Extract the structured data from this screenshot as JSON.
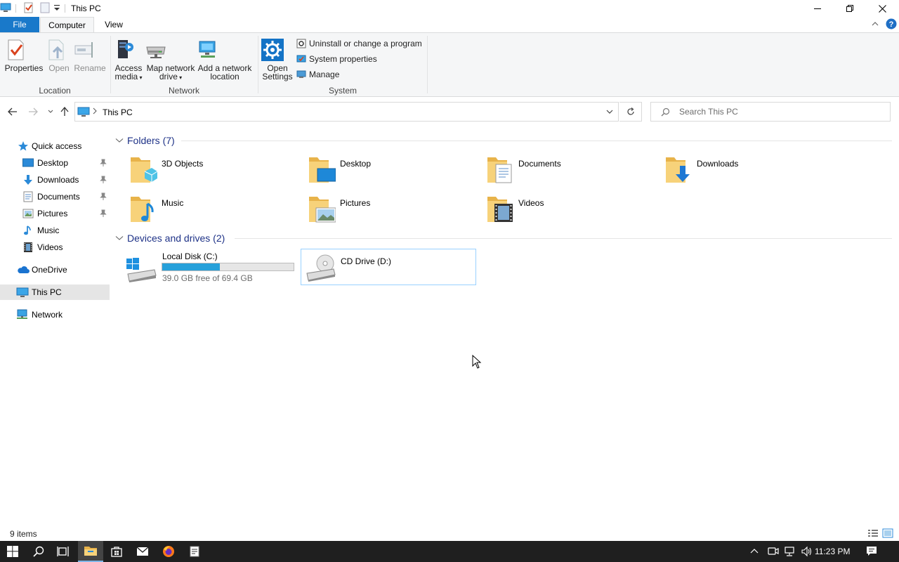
{
  "window": {
    "title": "This PC"
  },
  "ribbon_tabs": {
    "file": "File",
    "computer": "Computer",
    "view": "View"
  },
  "ribbon": {
    "location": {
      "label": "Location",
      "properties": "Properties",
      "open": "Open",
      "rename": "Rename"
    },
    "network": {
      "label": "Network",
      "access_media_1": "Access",
      "access_media_2": "media",
      "map_drive_1": "Map network",
      "map_drive_2": "drive",
      "add_location_1": "Add a network",
      "add_location_2": "location"
    },
    "system": {
      "label": "System",
      "open_settings_1": "Open",
      "open_settings_2": "Settings",
      "uninstall": "Uninstall or change a program",
      "system_properties": "System properties",
      "manage": "Manage"
    }
  },
  "address": {
    "path": "This PC",
    "search_placeholder": "Search This PC"
  },
  "nav_pane": {
    "quick_access": "Quick access",
    "items": [
      {
        "label": "Desktop",
        "pinned": true
      },
      {
        "label": "Downloads",
        "pinned": true
      },
      {
        "label": "Documents",
        "pinned": true
      },
      {
        "label": "Pictures",
        "pinned": true
      },
      {
        "label": "Music",
        "pinned": false
      },
      {
        "label": "Videos",
        "pinned": false
      }
    ],
    "onedrive": "OneDrive",
    "this_pc": "This PC",
    "network": "Network"
  },
  "content": {
    "folders_header": "Folders (7)",
    "folders": [
      "3D Objects",
      "Desktop",
      "Documents",
      "Downloads",
      "Music",
      "Pictures",
      "Videos"
    ],
    "drives_header": "Devices and drives (2)",
    "drives": [
      {
        "label": "Local Disk (C:)",
        "free_text": "39.0 GB free of 69.4 GB",
        "used_fraction": 0.438
      },
      {
        "label": "CD Drive (D:)"
      }
    ]
  },
  "status": {
    "items": "9 items"
  },
  "taskbar": {
    "time": "11:23 PM"
  },
  "colors": {
    "accent": "#1979ca",
    "folder": "#f3c85a",
    "header_text": "#1e3287",
    "drive_bar": "#26a0da",
    "taskbar": "#1f1f1f"
  }
}
